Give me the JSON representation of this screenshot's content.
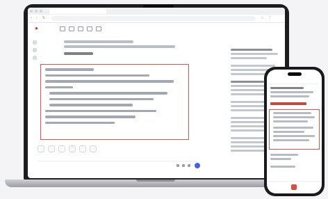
{
  "browser": {
    "tab_title": "",
    "url": ""
  },
  "brand": {
    "logo_text": "",
    "accent": "#2d55d6",
    "highlight_color": "#d9534f"
  },
  "page": {
    "header_label": "",
    "section_title": ""
  },
  "actions": [
    "",
    "",
    "",
    "",
    "",
    ""
  ],
  "icons": {
    "paw": "paw-icon",
    "tools": [
      "tool-icon",
      "tool-icon",
      "tool-icon",
      "tool-icon",
      "tool-icon"
    ],
    "send": "send-icon"
  }
}
